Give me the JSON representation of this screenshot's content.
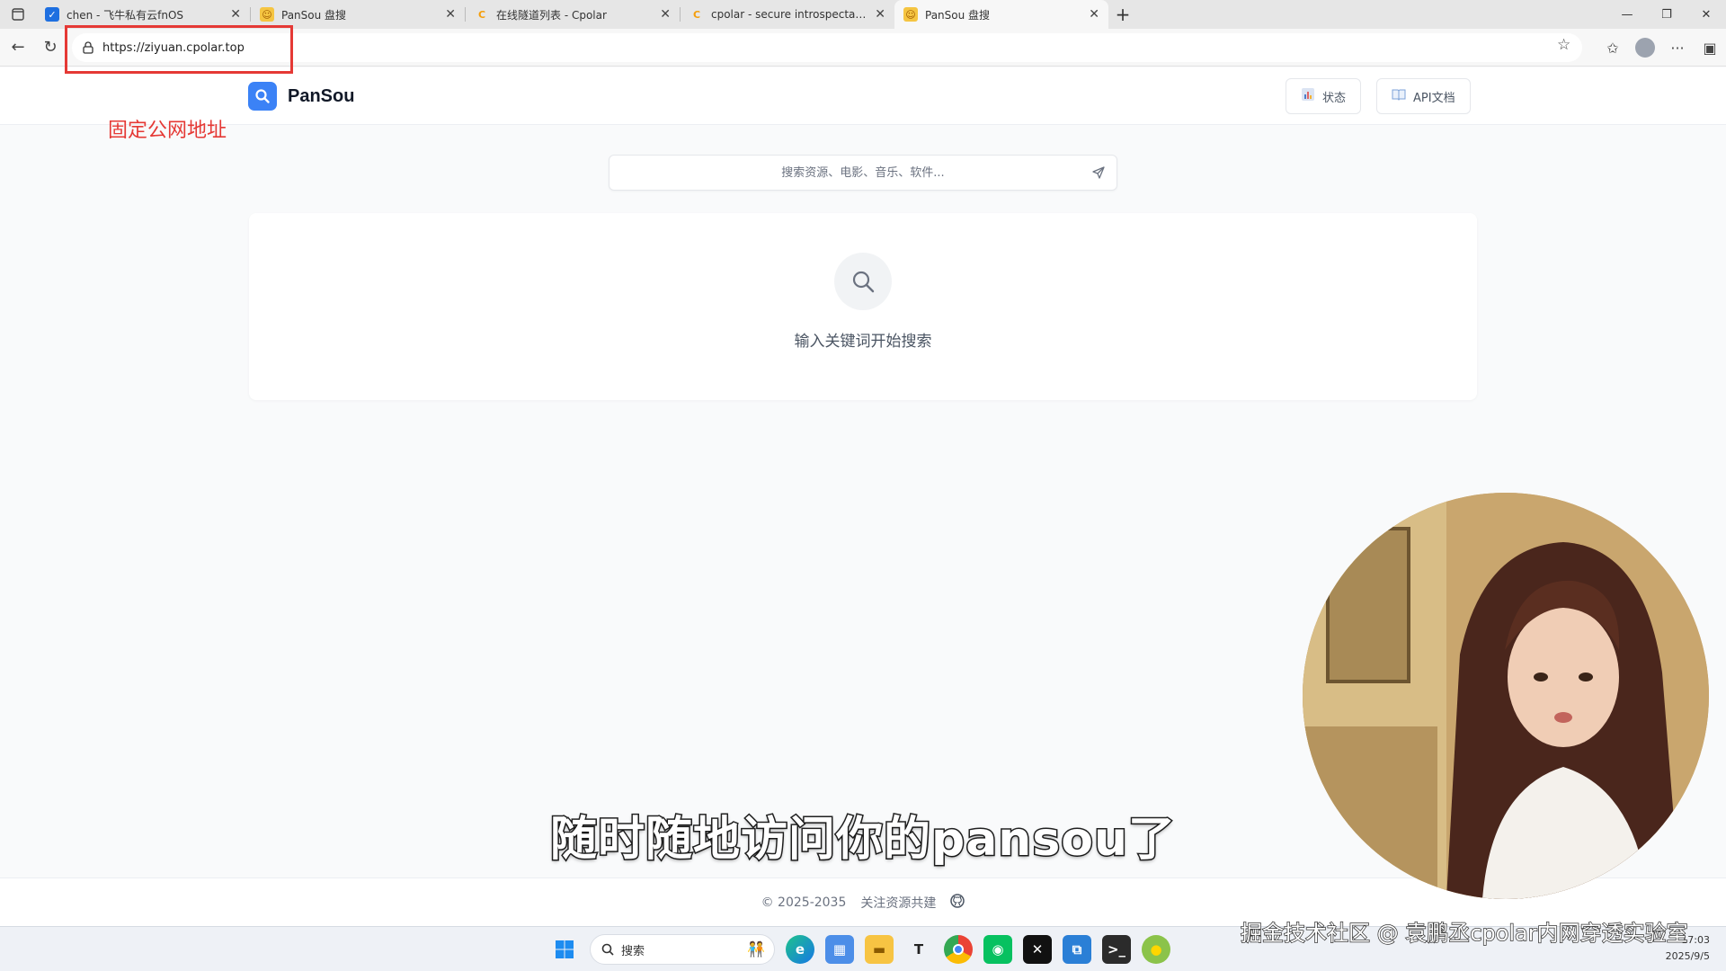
{
  "browser": {
    "tabs": [
      {
        "title": "chen - 飞牛私有云fnOS",
        "favicon_color": "#1e6fe0",
        "active": false
      },
      {
        "title": "PanSou 盘搜",
        "favicon_color": "#f5c542",
        "active": false
      },
      {
        "title": "在线隧道列表 - Cpolar",
        "favicon_color": "#f59e0b",
        "active": false
      },
      {
        "title": "cpolar - secure introspectable tur",
        "favicon_color": "#f59e0b",
        "active": false
      },
      {
        "title": "PanSou 盘搜",
        "favicon_color": "#f5c542",
        "active": true
      }
    ],
    "url": "https://ziyuan.cpolar.top"
  },
  "annotation": {
    "label": "固定公网地址",
    "color": "#e53935"
  },
  "site": {
    "logo_text": "PanSou",
    "brand_color": "#3b82f6",
    "header_buttons": [
      {
        "label": "状态",
        "icon": "chart-icon"
      },
      {
        "label": "API文档",
        "icon": "book-icon"
      }
    ],
    "search_placeholder": "搜索资源、电影、音乐、软件...",
    "empty_state_text": "输入关键词开始搜索",
    "footer": {
      "copyright": "© 2025-2035",
      "link_text": "关注资源共建",
      "icon": "github-icon"
    }
  },
  "video_overlay": {
    "subtitle": "随时随地访问你的pansou了",
    "watermark": "掘金技术社区 @ 袁鹏丞cpolar内网穿透实验室"
  },
  "taskbar": {
    "search_label": "搜索",
    "apps": [
      "edge-icon",
      "photos-icon",
      "file-explorer-icon",
      "typora-icon",
      "chrome-icon",
      "wechat-icon",
      "capcut-icon",
      "remote-desktop-icon",
      "terminal-icon",
      "app-icon"
    ],
    "time": "17:03",
    "date": "2025/9/5"
  }
}
